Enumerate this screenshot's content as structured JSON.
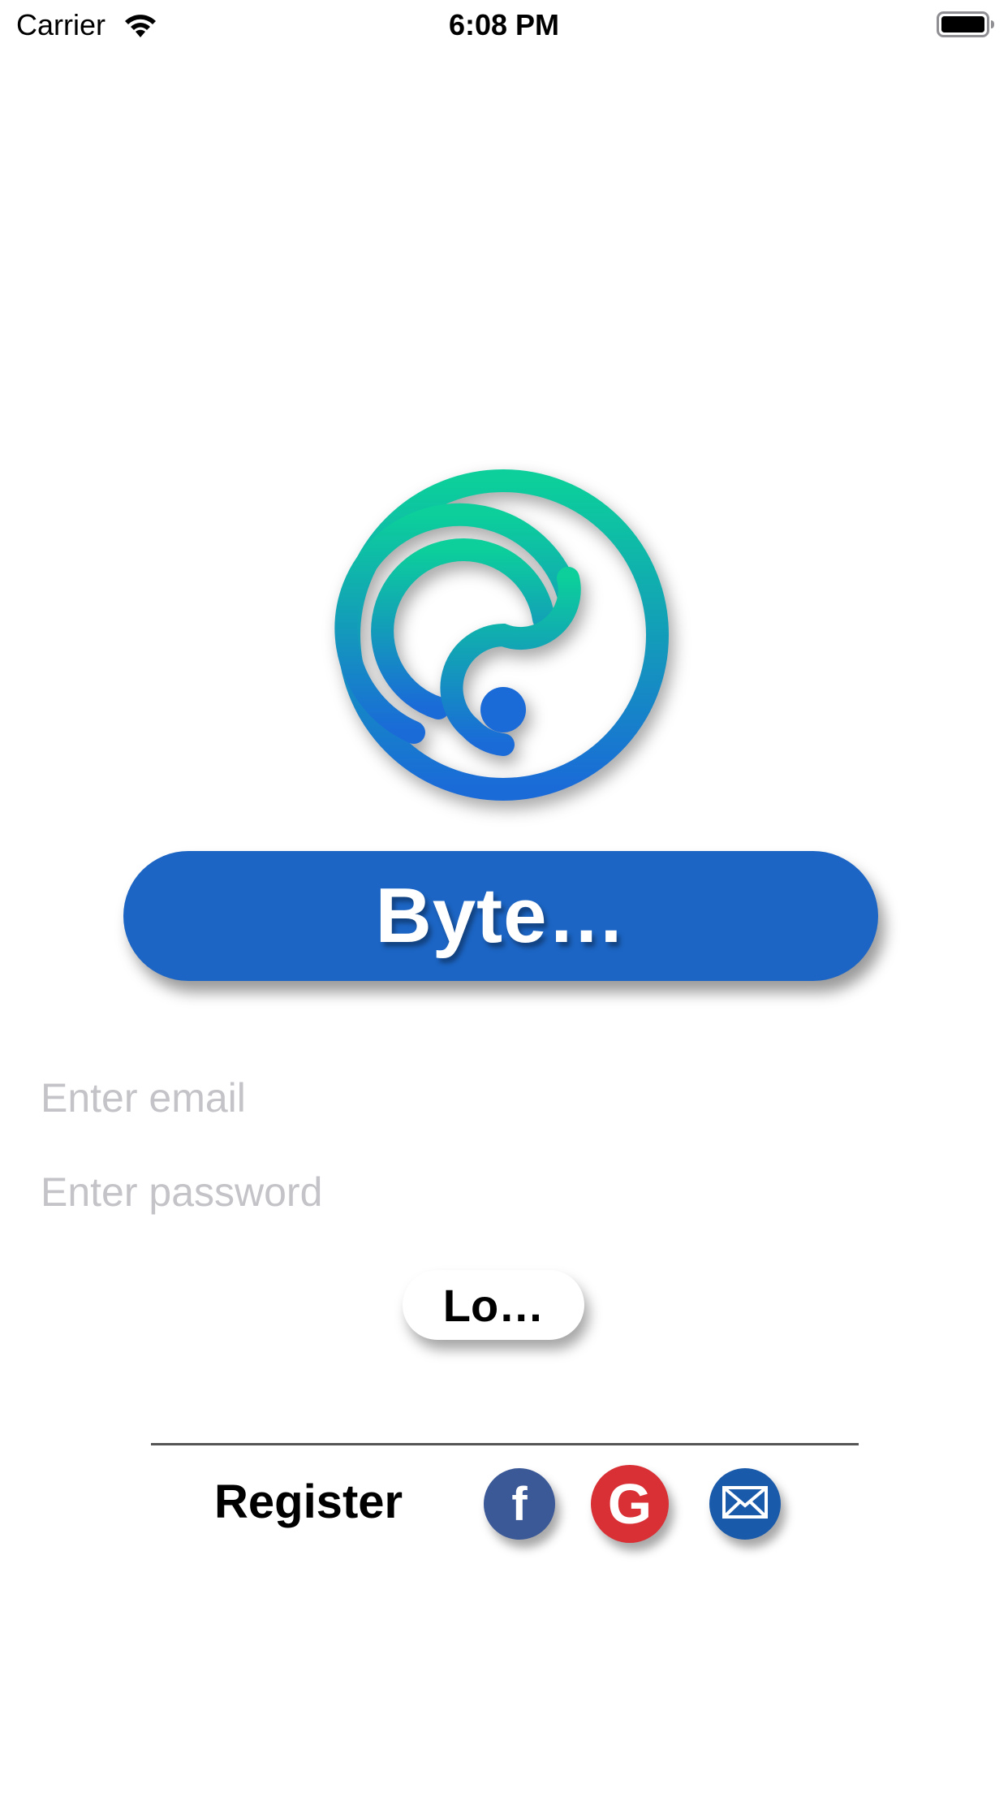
{
  "status_bar": {
    "carrier": "Carrier",
    "time": "6:08 PM",
    "icons": [
      "wifi-icon",
      "battery-icon"
    ]
  },
  "logo": {
    "icon": "app-logo-swirl",
    "gradient_top": "#0ccf9b",
    "gradient_bottom": "#1a6ad8"
  },
  "title": {
    "text": "Byte…",
    "color": "#1c65c4"
  },
  "form": {
    "email_placeholder": "Enter email",
    "email_value": "",
    "password_placeholder": "Enter password",
    "password_value": "",
    "login_label": "Lo…"
  },
  "footer": {
    "register_label": "Register",
    "social": [
      {
        "icon": "facebook-icon",
        "glyph": "f",
        "color": "#3b5897"
      },
      {
        "icon": "google-icon",
        "glyph": "G",
        "color": "#d93035"
      },
      {
        "icon": "mail-icon",
        "glyph": "",
        "color": "#1a5aaa"
      }
    ]
  }
}
